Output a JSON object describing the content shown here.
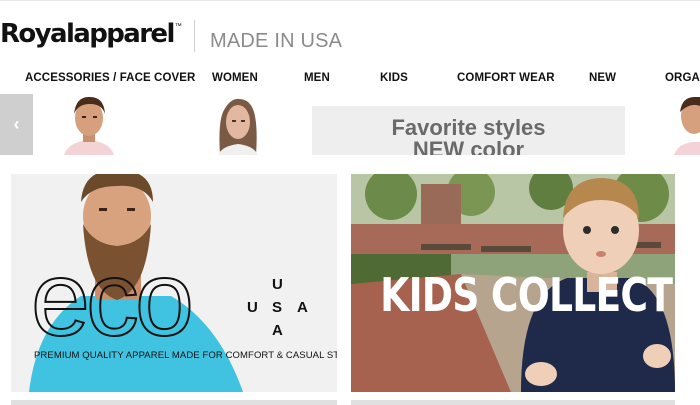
{
  "header": {
    "logo_text": "Royalapparel",
    "logo_tm": "™",
    "tagline": "MADE IN USA"
  },
  "nav": {
    "items": [
      {
        "label": "ACCESSORIES / FACE COVER"
      },
      {
        "label": "WOMEN"
      },
      {
        "label": "MEN"
      },
      {
        "label": "KIDS"
      },
      {
        "label": "COMFORT WEAR"
      },
      {
        "label": "NEW"
      },
      {
        "label": "ORGANIC"
      }
    ]
  },
  "carousel": {
    "prev_glyph": "‹",
    "promo": {
      "line1": "Favorite styles",
      "line2": "NEW color"
    }
  },
  "tiles": {
    "eco": {
      "word": "eco",
      "usa_letters": [
        "U",
        "U",
        "S",
        "A",
        "A"
      ],
      "subtitle": "PREMIUM QUALITY APPAREL MADE FOR COMFORT & CASUAL STYLE"
    },
    "kids": {
      "title": "KIDS COLLECTION"
    }
  },
  "colors": {
    "text": "#111111",
    "tagline_gray": "#8b8b8b",
    "nav_arrow_bg": "#cfcfcf",
    "promo_bg": "#eeeeee",
    "eco_shirt": "#3fc3e0"
  }
}
